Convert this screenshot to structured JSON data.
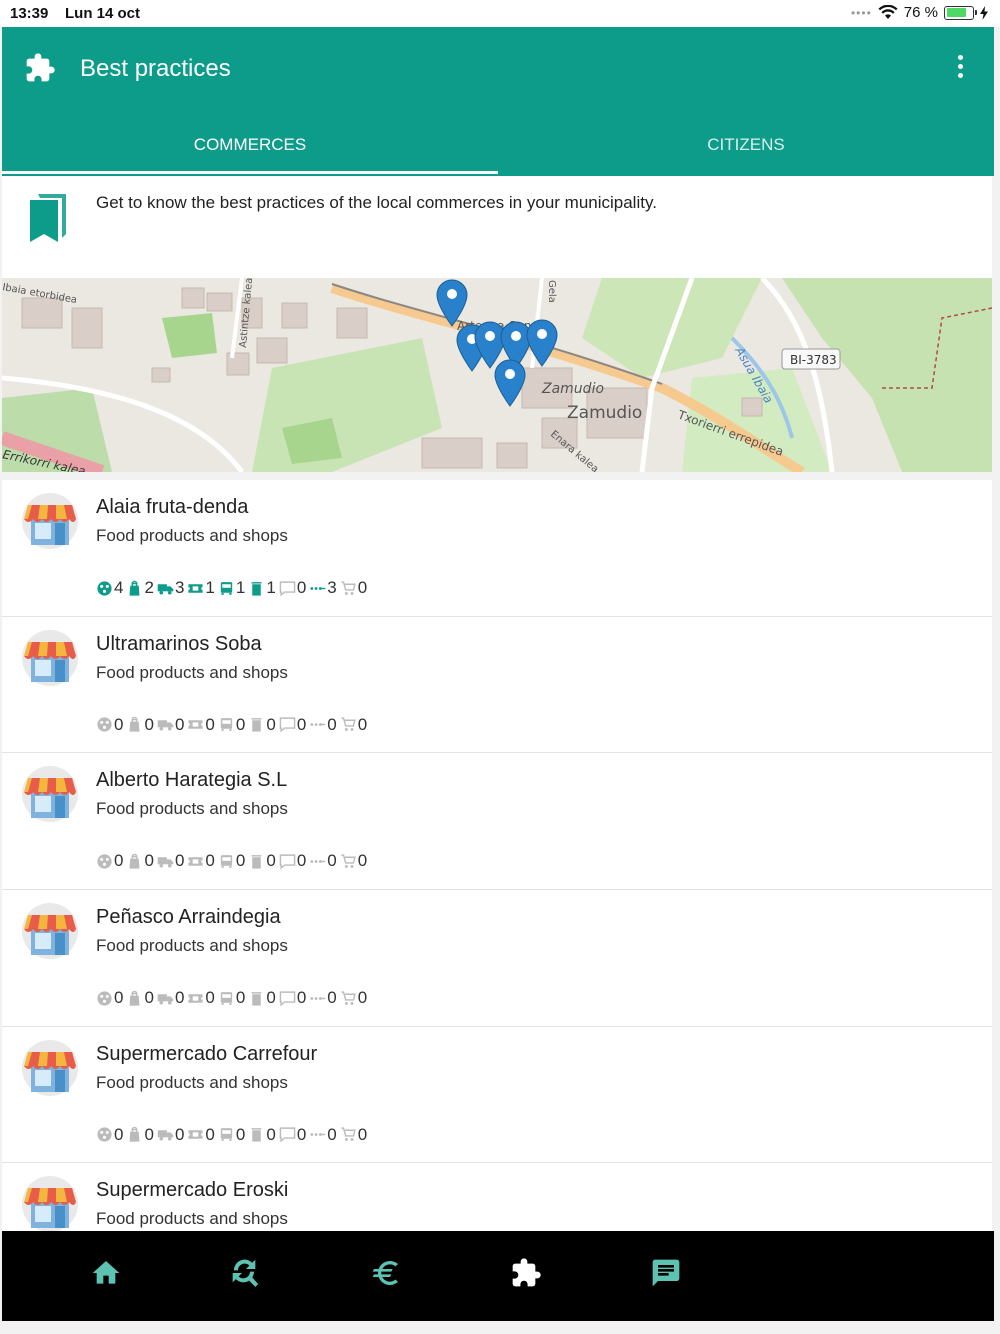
{
  "status_bar": {
    "time": "13:39",
    "date": "Lun 14 oct",
    "battery": "76 %",
    "battery_level": 0.76
  },
  "app_bar": {
    "title": "Best practices",
    "logo_icon": "puzzle-icon",
    "menu_icon": "more-vert-icon"
  },
  "tabs": [
    {
      "label": "COMMERCES",
      "active": true
    },
    {
      "label": "CITIZENS",
      "active": false
    }
  ],
  "intro": {
    "icon": "book-icon",
    "text": "Get to know the best practices of the local commerces in your municipality."
  },
  "map": {
    "labels": [
      "Ibaia etorbidea",
      "Astintze kalea",
      "Arteaga-San",
      "Zamudio",
      "Zamudio",
      "Txorierri errepidea",
      "Asua Ibaia",
      "BI-3783",
      "Errikorri kalea",
      "Enara kalea",
      "Gela"
    ],
    "marker_icon": "map-pin-icon",
    "marker_count": 6
  },
  "commerces": [
    {
      "name": "Alaia fruta-denda",
      "category": "Food products and shops",
      "stats": [
        "4",
        "2",
        "3",
        "1",
        "1",
        "1",
        "0",
        "3",
        "0"
      ]
    },
    {
      "name": "Ultramarinos Soba",
      "category": "Food products and shops",
      "stats": [
        "0",
        "0",
        "0",
        "0",
        "0",
        "0",
        "0",
        "0",
        "0"
      ]
    },
    {
      "name": "Alberto Harategia S.L",
      "category": "Food products and shops",
      "stats": [
        "0",
        "0",
        "0",
        "0",
        "0",
        "0",
        "0",
        "0",
        "0"
      ]
    },
    {
      "name": "Peñasco Arraindegia",
      "category": "Food products and shops",
      "stats": [
        "0",
        "0",
        "0",
        "0",
        "0",
        "0",
        "0",
        "0",
        "0"
      ]
    },
    {
      "name": "Supermercado Carrefour",
      "category": "Food products and shops",
      "stats": [
        "0",
        "0",
        "0",
        "0",
        "0",
        "0",
        "0",
        "0",
        "0"
      ]
    },
    {
      "name": "Supermercado Eroski",
      "category": "Food products and shops",
      "stats": []
    }
  ],
  "stat_icons": [
    "recycle-icon",
    "bag-icon",
    "truck-icon",
    "ticket-icon",
    "bus-icon",
    "bin-icon",
    "chat-icon",
    "dots-icon",
    "cart-icon"
  ],
  "colors": {
    "primary": "#0d9b8a",
    "nav_icon": "#5ec2b3",
    "inactive_stat": "#bbbbbb"
  },
  "bottom_nav": [
    {
      "icon": "home-icon",
      "active": false
    },
    {
      "icon": "search-refresh-icon",
      "active": false
    },
    {
      "icon": "euro-icon",
      "active": false
    },
    {
      "icon": "puzzle-icon",
      "active": true
    },
    {
      "icon": "message-icon",
      "active": false
    }
  ]
}
